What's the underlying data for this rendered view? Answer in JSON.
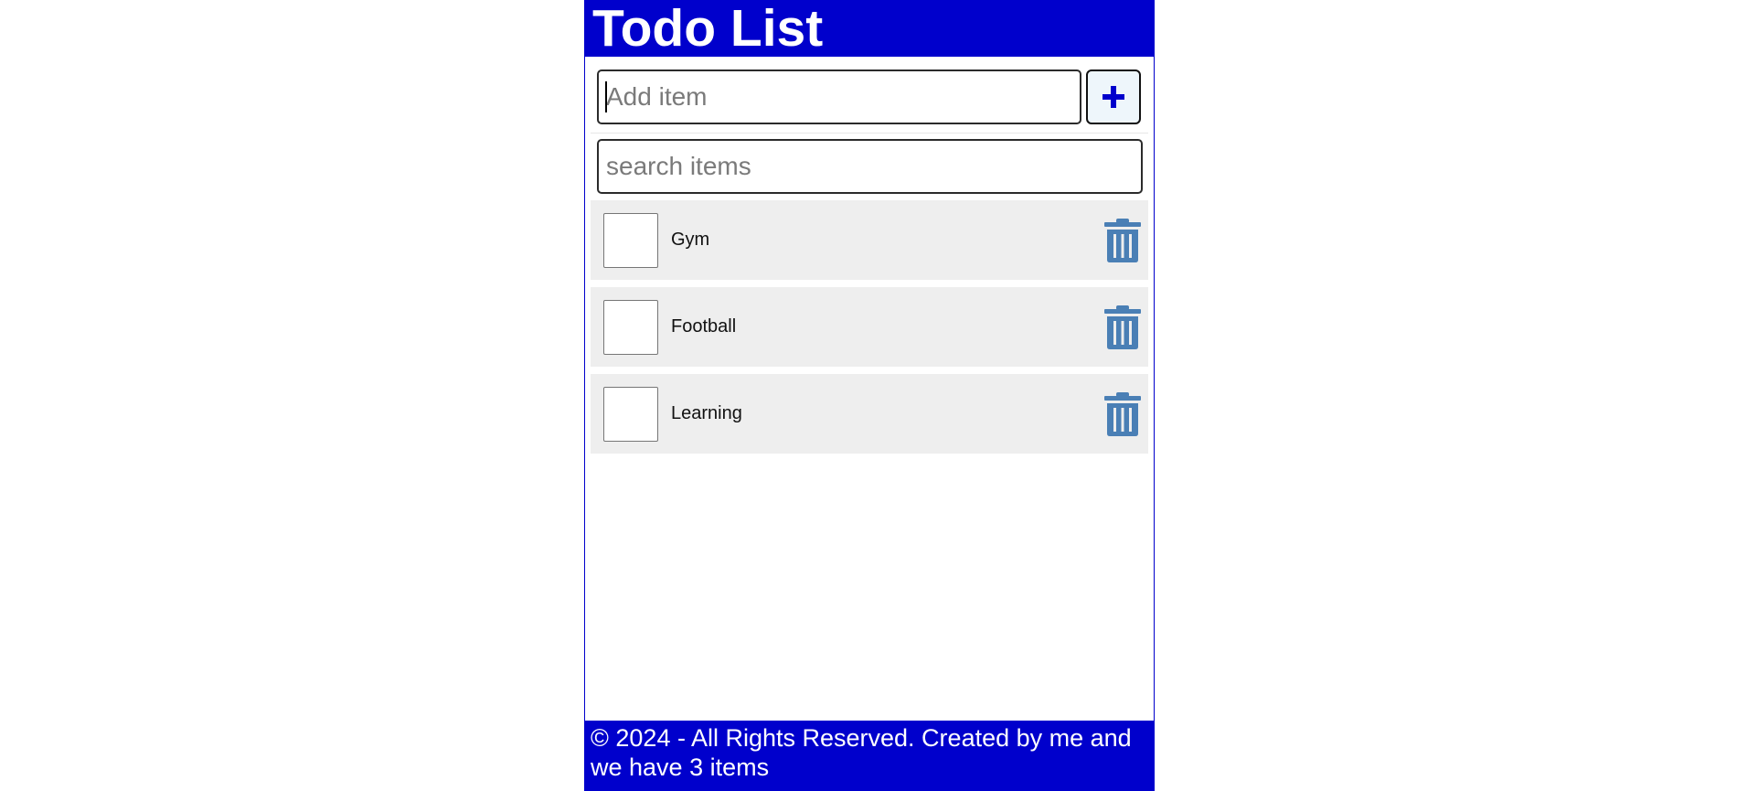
{
  "header": {
    "title": "Todo List"
  },
  "add": {
    "placeholder": "Add item",
    "value": "",
    "button_icon": "plus-icon"
  },
  "search": {
    "placeholder": "search items",
    "value": ""
  },
  "items": [
    {
      "label": "Gym",
      "checked": false
    },
    {
      "label": "Football",
      "checked": false
    },
    {
      "label": "Learning",
      "checked": false
    }
  ],
  "footer": {
    "text": "© 2024 - All Rights Reserved. Created by me and we have 3 items"
  },
  "colors": {
    "brand": "#0000cc",
    "item_bg": "#eeeeee",
    "trash": "#4a7fb5"
  }
}
